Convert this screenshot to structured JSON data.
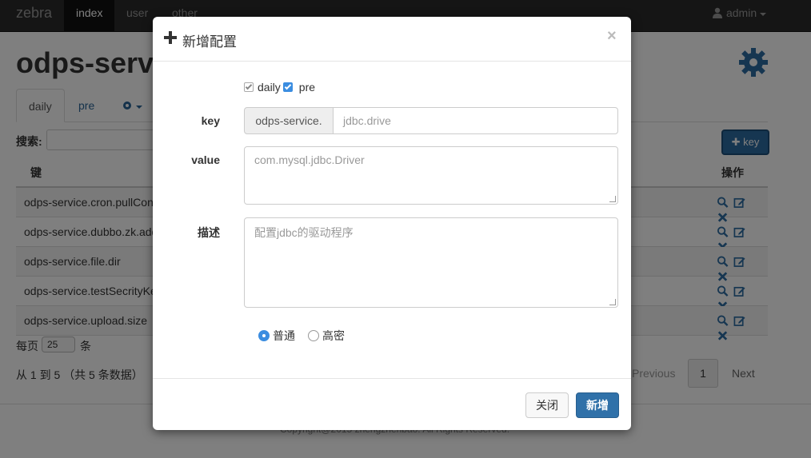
{
  "navbar": {
    "brand": "zebra",
    "items": [
      {
        "label": "index",
        "active": true
      },
      {
        "label": "user",
        "active": false
      },
      {
        "label": "other",
        "active": false
      }
    ],
    "user": "admin"
  },
  "page": {
    "title": "odps-service",
    "tabs": [
      {
        "label": "daily",
        "active": true
      },
      {
        "label": "pre",
        "active": false
      }
    ],
    "search_label": "搜索:",
    "add_key_label": "key",
    "columns": {
      "key": "键",
      "ops": "操作"
    },
    "rows": [
      {
        "key": "odps-service.cron.pullConfig"
      },
      {
        "key": "odps-service.dubbo.zk.address"
      },
      {
        "key": "odps-service.file.dir"
      },
      {
        "key": "odps-service.testSecrityKey"
      },
      {
        "key": "odps-service.upload.size"
      }
    ],
    "per_page_prefix": "每页",
    "per_page_value": "25",
    "per_page_suffix": "条",
    "info": "从 1 到 5 （共 5 条数据）",
    "pagination": {
      "prev": "Previous",
      "current": "1",
      "next": "Next"
    },
    "footer": "Copyright@2015 zhengzhenbao. All Rights Reserved."
  },
  "modal": {
    "title": "新增配置",
    "close_glyph": "×",
    "envs": [
      {
        "label": "daily",
        "checked": true,
        "disabled": true
      },
      {
        "label": "pre",
        "checked": true,
        "disabled": false
      }
    ],
    "key_label": "key",
    "key_prefix": "odps-service.",
    "key_placeholder": "jdbc.drive",
    "value_label": "value",
    "value_placeholder": "com.mysql.jdbc.Driver",
    "desc_label": "描述",
    "desc_placeholder": "配置jdbc的驱动程序",
    "levels": [
      {
        "label": "普通",
        "checked": true
      },
      {
        "label": "高密",
        "checked": false
      }
    ],
    "close_button": "关闭",
    "submit_button": "新增"
  },
  "colors": {
    "accent": "#3071a9",
    "navbar": "#2b2b2b",
    "link": "#2a6496",
    "checkbox": "#3b8de0"
  }
}
